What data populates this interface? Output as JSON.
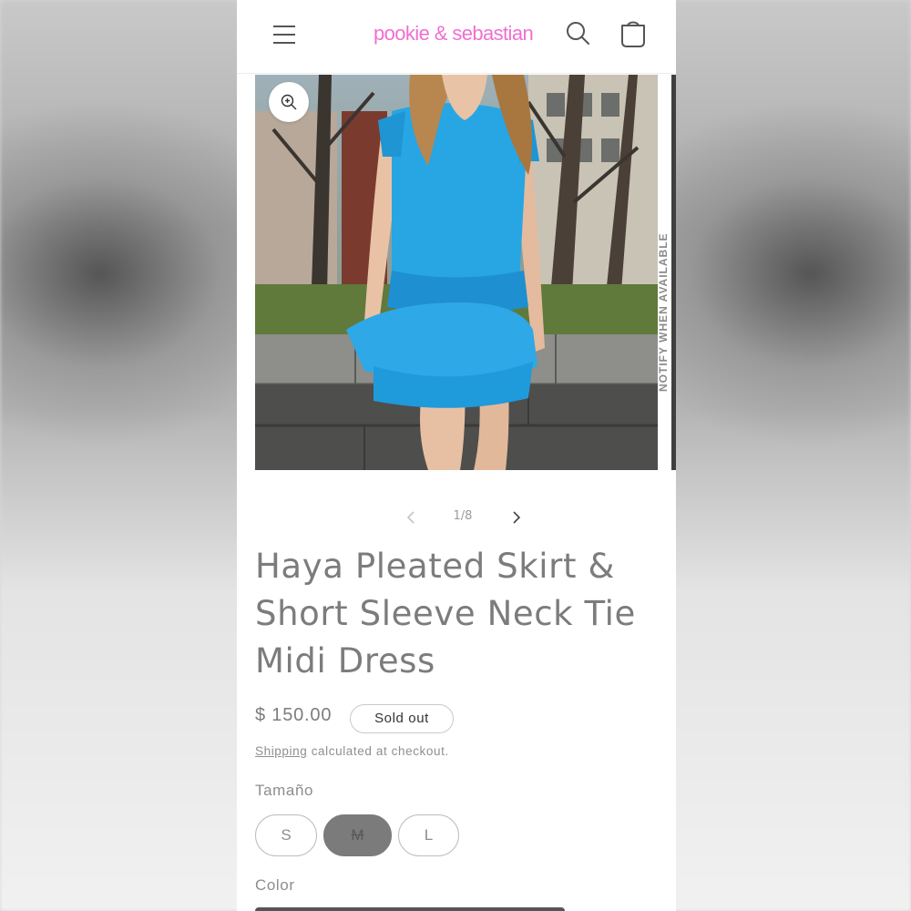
{
  "header": {
    "brand": "pookie & sebastian",
    "brand_color": "#f06fd1",
    "icons": [
      "menu-icon",
      "search-icon",
      "cart-icon"
    ]
  },
  "gallery": {
    "counter": "1/8",
    "side_text": "NOTIFY WHEN AVAILABLE",
    "icons": [
      "zoom-in-icon",
      "chevron-left-icon",
      "chevron-right-icon"
    ]
  },
  "product": {
    "title": "Haya Pleated Skirt & Short Sleeve Neck Tie Midi Dress",
    "price": "$ 150.00",
    "status_badge": "Sold out",
    "shipping_link": "Shipping",
    "shipping_text": " calculated at checkout."
  },
  "options": {
    "size_label": "Tamaño",
    "sizes": [
      "S",
      "M",
      "L"
    ],
    "selected_size": "M",
    "color_label": "Color"
  }
}
